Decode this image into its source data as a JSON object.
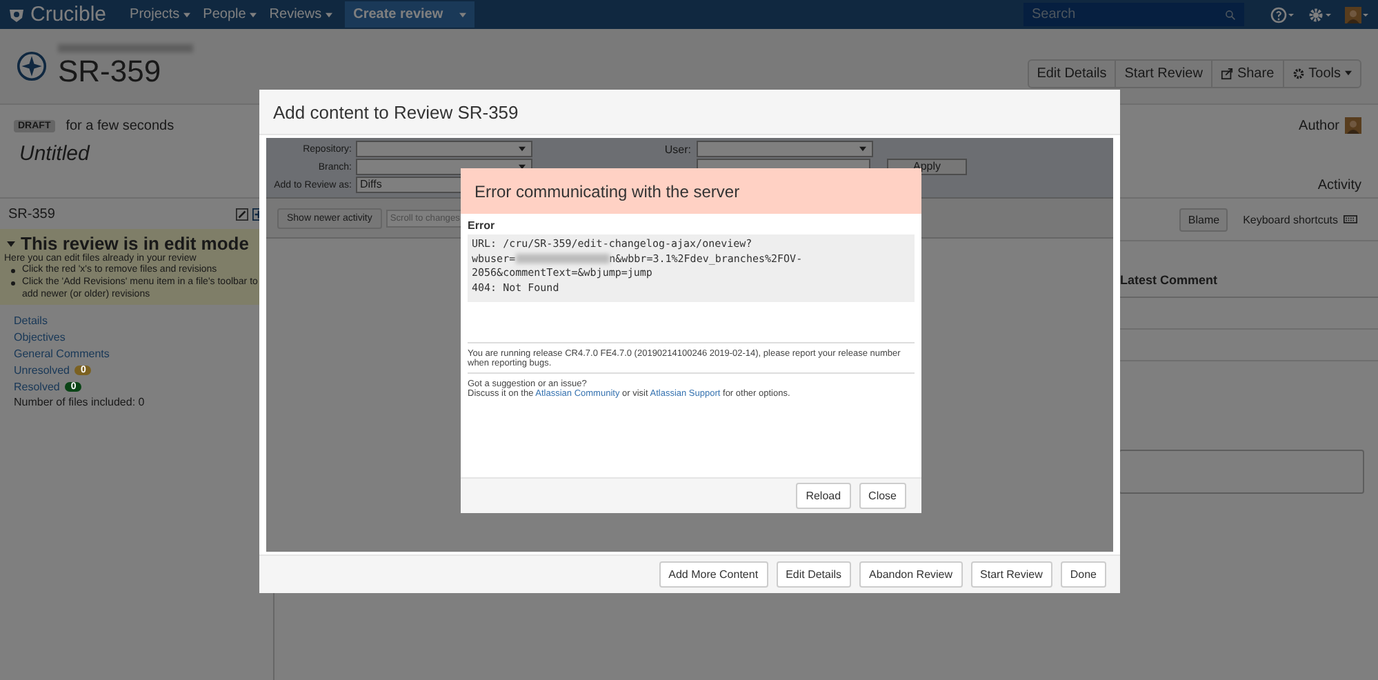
{
  "top_nav": {
    "logo": "Crucible",
    "menus": [
      {
        "label": "Projects"
      },
      {
        "label": "People"
      },
      {
        "label": "Reviews"
      }
    ],
    "create_button": "Create review",
    "search": {
      "placeholder": "Search"
    }
  },
  "review_header": {
    "key": "SR-359",
    "actions": [
      "Edit Details",
      "Start Review",
      "Share",
      "Tools"
    ]
  },
  "review_info": {
    "status": "DRAFT",
    "age": "for a few seconds",
    "title": "Untitled",
    "author_label": "Author",
    "activity_label": "Activity"
  },
  "sidebar": {
    "title": "SR-359",
    "edit_mode": {
      "heading": "This review is in edit mode",
      "intro": "Here you can edit files already in your review",
      "bullets": [
        "Click the red 'x's to remove files and revisions",
        "Click the 'Add Revisions' menu item in a file's toolbar to add newer (or older) revisions"
      ]
    },
    "links": [
      {
        "label": "Details"
      },
      {
        "label": "Objectives"
      },
      {
        "label": "General Comments"
      },
      {
        "label": "Unresolved",
        "count": "0",
        "color": "#7b6121"
      },
      {
        "label": "Resolved",
        "count": "0",
        "color": "#0a4416"
      }
    ],
    "files_included": "Number of files included: 0"
  },
  "content": {
    "toolbar_buttons": [
      "Blame",
      "Keyboard shortcuts"
    ],
    "column_heading": "Latest Comment"
  },
  "modal": {
    "title": "Add content to Review SR-359",
    "fields": [
      {
        "label": "Repository:"
      },
      {
        "label": "User:"
      },
      {
        "label": "Branch:"
      },
      {
        "label": "Add to Review as:",
        "value": "Diffs"
      }
    ],
    "apply_button": "Apply",
    "show_newer_button": "Show newer activity",
    "scroll_field": {
      "placeholder": "Scroll to changes"
    },
    "buttons": [
      "Add More Content",
      "Edit Details",
      "Abandon Review",
      "Start Review",
      "Done"
    ]
  },
  "error_dialog": {
    "title": "Error communicating with the server",
    "label": "Error",
    "details": [
      "URL: /cru/SR-359/edit-changelog-ajax/oneview?",
      "wbuser=",
      "n&wbbr=3.1%2Fdev_branches%2FOV-",
      "2056&commentText=&wbjump=jump",
      "404: Not Found"
    ],
    "release_note": "You are running release CR4.7.0 FE4.7.0 (20190214100246 2019-02-14), please report your release number when reporting bugs.",
    "suggestion": "Got a suggestion or an issue?",
    "discuss": {
      "before": "Discuss it on the",
      "link1": "Atlassian Community",
      "middle": "or visit",
      "link2": "Atlassian Support",
      "after": "for other options."
    },
    "buttons": [
      "Reload",
      "Close"
    ]
  }
}
